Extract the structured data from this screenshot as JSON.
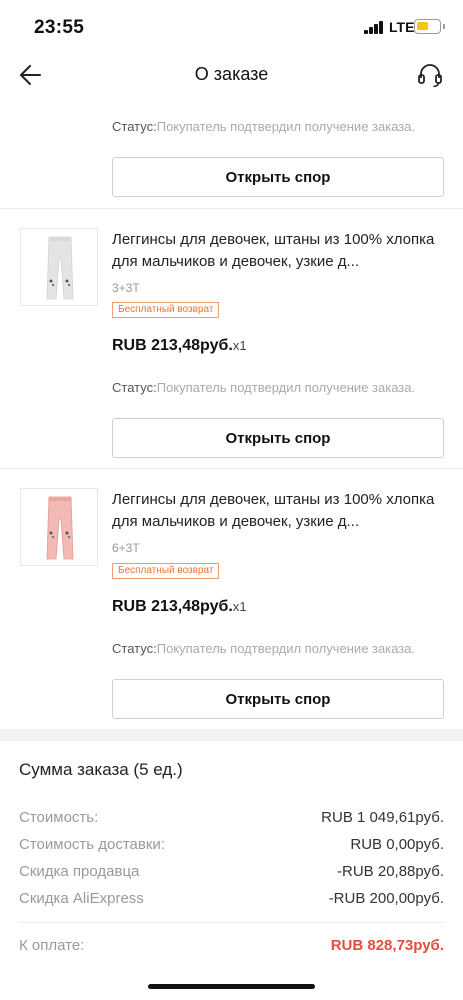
{
  "statusbar": {
    "time": "23:55",
    "carrier": "LTE",
    "battery_color": "#f5c518"
  },
  "header": {
    "title": "О заказе",
    "back_icon": "arrow-left-icon",
    "support_icon": "headset-icon"
  },
  "top_item": {
    "status_label": "Статус:",
    "status_value": "Покупатель подтвердил получение заказа.",
    "dispute_label": "Открыть спор"
  },
  "items": [
    {
      "title": "Леггинсы для девочек, штаны из 100% хлопка для мальчиков и девочек, узкие д...",
      "variant": "3+3T",
      "badge": "Бесплатный возврат",
      "price": "RUB 213,48руб.",
      "qty": "x1",
      "status_label": "Статус:",
      "status_value": "Покупатель подтвердил получение заказа.",
      "dispute_label": "Открыть спор",
      "image_color": "#e8e8e8"
    },
    {
      "title": "Леггинсы для девочек, штаны из 100% хлопка для мальчиков и девочек, узкие д...",
      "variant": "6+3T",
      "badge": "Бесплатный возврат",
      "price": "RUB 213,48руб.",
      "qty": "x1",
      "status_label": "Статус:",
      "status_value": "Покупатель подтвердил получение заказа.",
      "dispute_label": "Открыть спор",
      "image_color": "#f3b9b5"
    }
  ],
  "summary": {
    "title": "Сумма заказа (5 ед.)",
    "rows": [
      {
        "label": "Стоимость:",
        "value": "RUB 1 049,61руб."
      },
      {
        "label": "Стоимость доставки:",
        "value": "RUB 0,00руб."
      },
      {
        "label": "Скидка продавца",
        "value": "-RUB 20,88руб."
      },
      {
        "label": "Скидка AliExpress",
        "value": "-RUB 200,00руб."
      }
    ],
    "total_label": "К оплате:",
    "total_value": "RUB 828,73руб.",
    "total_color": "#e74c3c"
  }
}
